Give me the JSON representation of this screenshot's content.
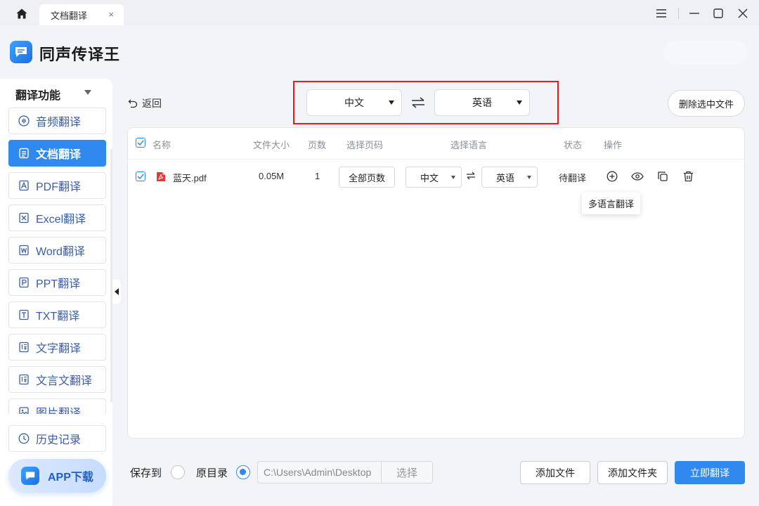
{
  "titlebar": {
    "tab_label": "文档翻译",
    "tab_close": "×"
  },
  "header": {
    "app_name": "同声传译王"
  },
  "sidebar": {
    "title": "翻译功能",
    "items": [
      {
        "label": "音频翻译",
        "icon": "audio-icon"
      },
      {
        "label": "文档翻译",
        "icon": "document-icon",
        "active": true
      },
      {
        "label": "PDF翻译",
        "icon": "pdf-icon"
      },
      {
        "label": "Excel翻译",
        "icon": "excel-icon"
      },
      {
        "label": "Word翻译",
        "icon": "word-icon"
      },
      {
        "label": "PPT翻译",
        "icon": "ppt-icon"
      },
      {
        "label": "TXT翻译",
        "icon": "txt-icon"
      },
      {
        "label": "文字翻译",
        "icon": "text-translate-icon"
      },
      {
        "label": "文言文翻译",
        "icon": "classical-chinese-icon"
      },
      {
        "label": "图片翻译",
        "icon": "image-icon"
      }
    ],
    "history_label": "历史记录",
    "app_download_label": "APP下载"
  },
  "toolbar": {
    "back_label": "返回",
    "source_lang": "中文",
    "target_lang": "英语",
    "delete_selected_label": "删除选中文件"
  },
  "table": {
    "headers": {
      "name": "名称",
      "size": "文件大小",
      "pages": "页数",
      "page_select": "选择页码",
      "lang_select": "选择语言",
      "status": "状态",
      "actions": "操作"
    },
    "rows": [
      {
        "name": "蓝天.pdf",
        "size": "0.05M",
        "pages": "1",
        "page_range": "全部页数",
        "source_lang": "中文",
        "target_lang": "英语",
        "status": "待翻译"
      }
    ],
    "tooltip": "多语言翻译"
  },
  "bottom": {
    "save_to_label": "保存到",
    "original_dir_label": "原目录",
    "path_value": "C:\\Users\\Admin\\Desktop",
    "choose_label": "选择",
    "add_file_label": "添加文件",
    "add_folder_label": "添加文件夹",
    "translate_now_label": "立即翻译"
  },
  "colors": {
    "accent": "#2f89ee",
    "highlight_border": "#e02020",
    "pdf_red": "#e5383b"
  }
}
